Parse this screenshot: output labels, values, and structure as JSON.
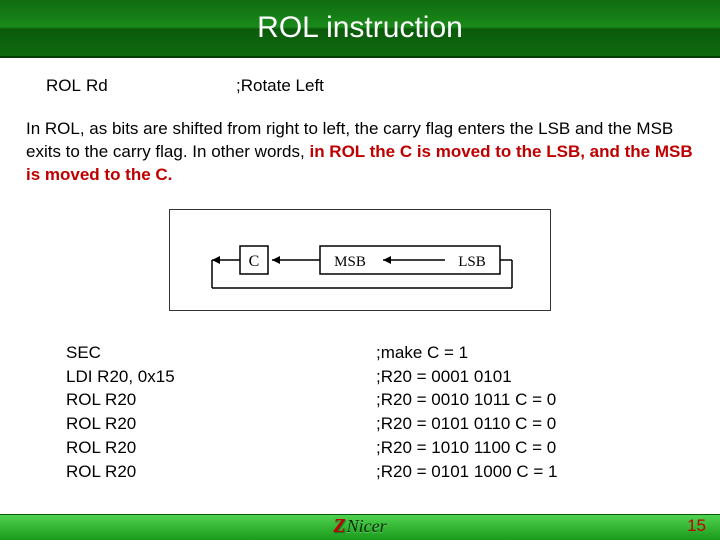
{
  "title": "ROL instruction",
  "signature": {
    "mnemonic": "ROL",
    "operand": "Rd",
    "comment": ";Rotate Left"
  },
  "description": {
    "plain": "In ROL, as bits are shifted from right to left, the carry flag enters the LSB and the MSB exits to the carry flag. In other words, ",
    "bold_red": "in ROL the C is moved to the LSB, and the MSB is moved to the C."
  },
  "diagram": {
    "c_label": "C",
    "msb_label": "MSB",
    "lsb_label": "LSB"
  },
  "code": {
    "left": [
      "SEC",
      "LDI R20, 0x15",
      "ROL R20",
      "ROL R20",
      "ROL R20",
      "ROL R20"
    ],
    "right": [
      ";make C = 1",
      "  ;R20 = 0001 0101",
      ";R20 = 0010 1011  C = 0",
      ";R20 = 0101 0110  C = 0",
      ";R20 = 1010 1100  C = 0",
      ";R20 = 0101 1000  C = 1"
    ]
  },
  "logo": {
    "z": "Z",
    "nicer": "Nicer"
  },
  "page_number": "15"
}
